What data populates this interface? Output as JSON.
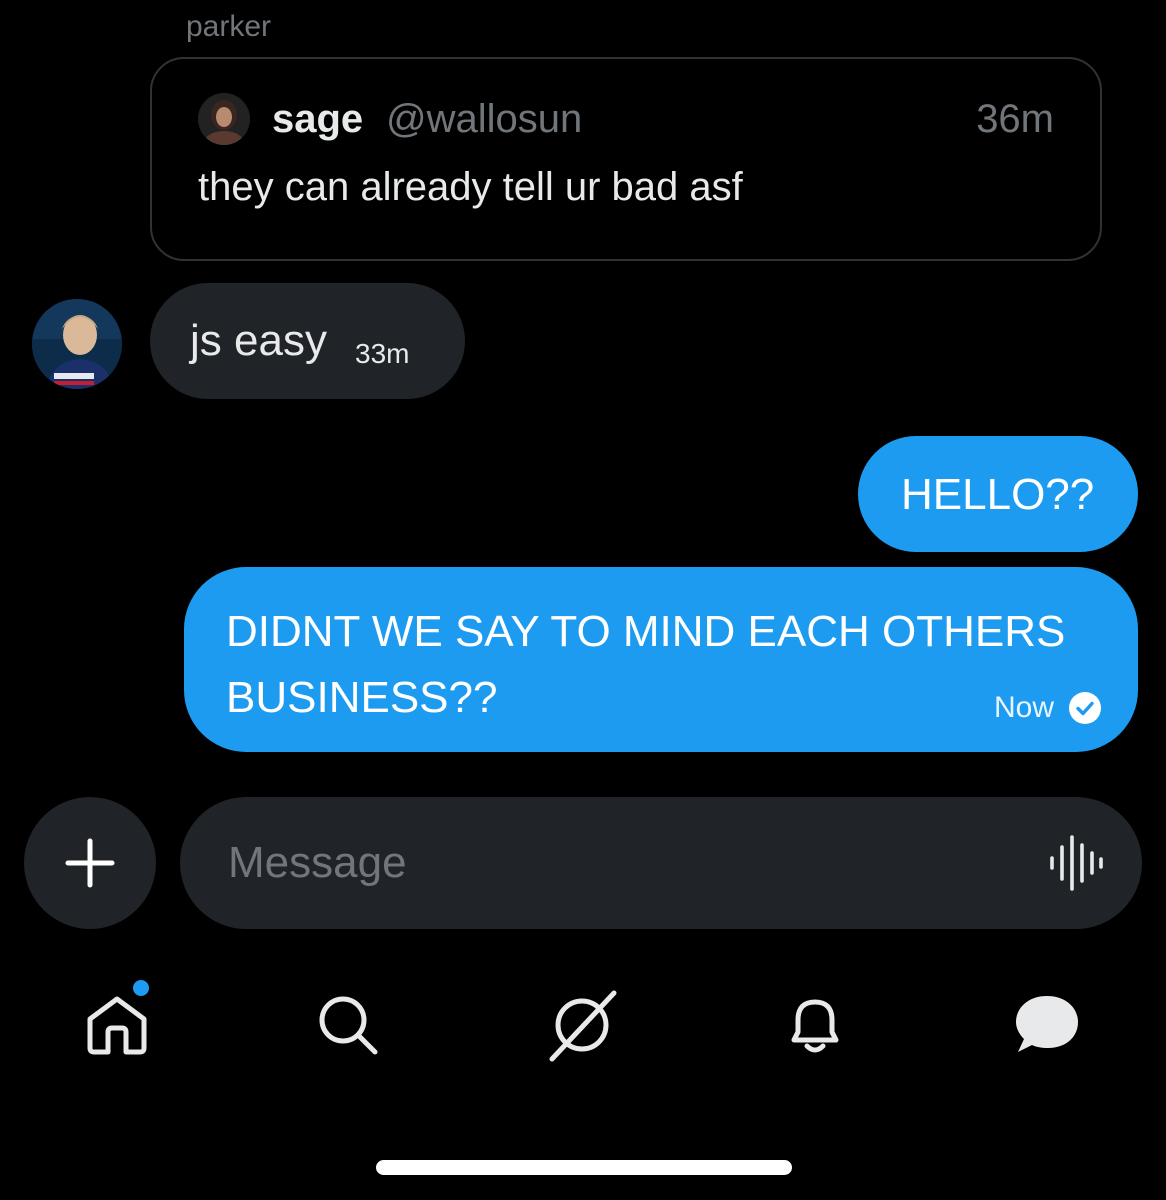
{
  "conversation": {
    "sender_label": "parker"
  },
  "quoted_post": {
    "author_name": "sage",
    "author_handle": "@wallosun",
    "time": "36m",
    "text": "they can already tell ur bad asf"
  },
  "messages": [
    {
      "direction": "received",
      "text": "js easy",
      "time": "33m"
    },
    {
      "direction": "sent",
      "text": "HELLO??"
    },
    {
      "direction": "sent",
      "text": "DIDNT WE SAY TO MIND EACH OTHERS BUSINESS??",
      "time": "Now",
      "status": "read-check-icon"
    }
  ],
  "composer": {
    "placeholder": "Message",
    "value": ""
  },
  "nav": {
    "items": [
      "home-icon",
      "search-icon",
      "grok-icon",
      "notifications-icon",
      "messages-icon"
    ],
    "home_has_unread": true
  },
  "colors": {
    "accent": "#1d9bf0",
    "background": "#000000",
    "bubble_received": "#202327",
    "secondary_text": "#71767b"
  }
}
